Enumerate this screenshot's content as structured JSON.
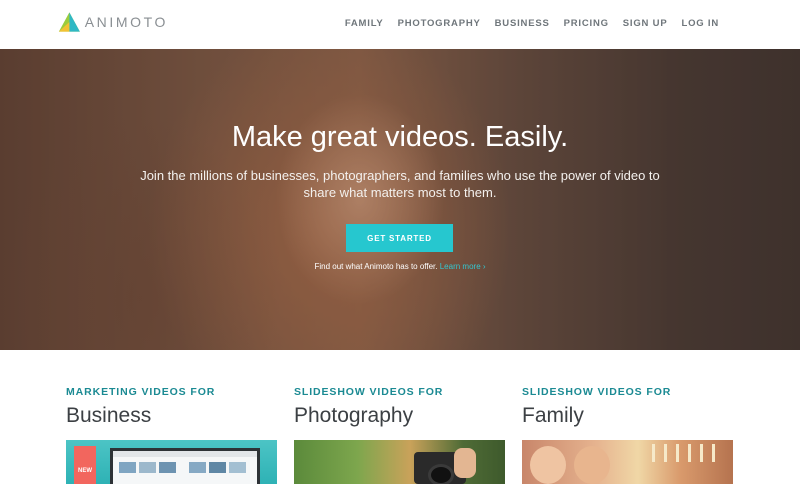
{
  "header": {
    "logo_text": "ANIMOTO",
    "nav": [
      "FAMILY",
      "PHOTOGRAPHY",
      "BUSINESS",
      "PRICING",
      "SIGN UP",
      "LOG IN"
    ]
  },
  "hero": {
    "title": "Make great videos. Easily.",
    "subtitle": "Join the millions of businesses, photographers, and families who use the power of video to share what matters most to them.",
    "cta_label": "GET STARTED",
    "more_text": "Find out what Animoto has to offer.",
    "more_link": "Learn more ›"
  },
  "cards": [
    {
      "kicker": "MARKETING VIDEOS FOR",
      "title": "Business",
      "badge": "NEW"
    },
    {
      "kicker": "SLIDESHOW VIDEOS FOR",
      "title": "Photography"
    },
    {
      "kicker": "SLIDESHOW VIDEOS FOR",
      "title": "Family"
    }
  ],
  "colors": {
    "accent": "#26c7cf",
    "kicker": "#1b8a93",
    "nav_text": "#6f767b",
    "badge": "#f2665e"
  }
}
